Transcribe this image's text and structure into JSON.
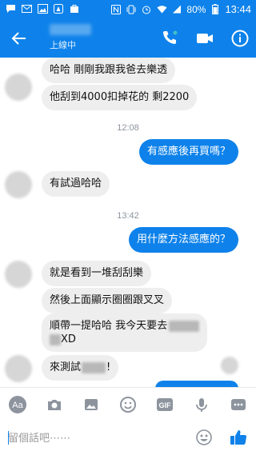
{
  "status_bar": {
    "battery": "80%",
    "time": "13:44"
  },
  "header": {
    "status": "上線中"
  },
  "messages": {
    "m1": "哈哈 剛剛我跟我爸去樂透",
    "m2": "他刮到4000扣掉花的 剩2200",
    "ts1": "12:08",
    "m3": "有感應後再買嗎？",
    "m4": "有試過哈哈",
    "ts2": "13:42",
    "m5": "用什麼方法感應的？",
    "m6": "就是看到一堆刮刮樂",
    "m7": "然後上面顯示圈圈跟叉叉",
    "m8a": "順帶一提哈哈 我今天要去",
    "m8b": "XD",
    "m9": "來測試",
    "m9b": "!"
  },
  "composer": {
    "placeholder": "留個話吧⋯⋯"
  },
  "colors": {
    "brand": "#0e82ea",
    "incoming": "#eeeeee",
    "like": "#0e82ea"
  },
  "icons": [
    "back-arrow-icon",
    "phone-icon",
    "video-camera-icon",
    "info-icon",
    "keyboard-aa-icon",
    "camera-icon",
    "gallery-icon",
    "emoji-icon",
    "gif-icon",
    "more-icon",
    "sticker-icon",
    "like-thumb-icon"
  ]
}
